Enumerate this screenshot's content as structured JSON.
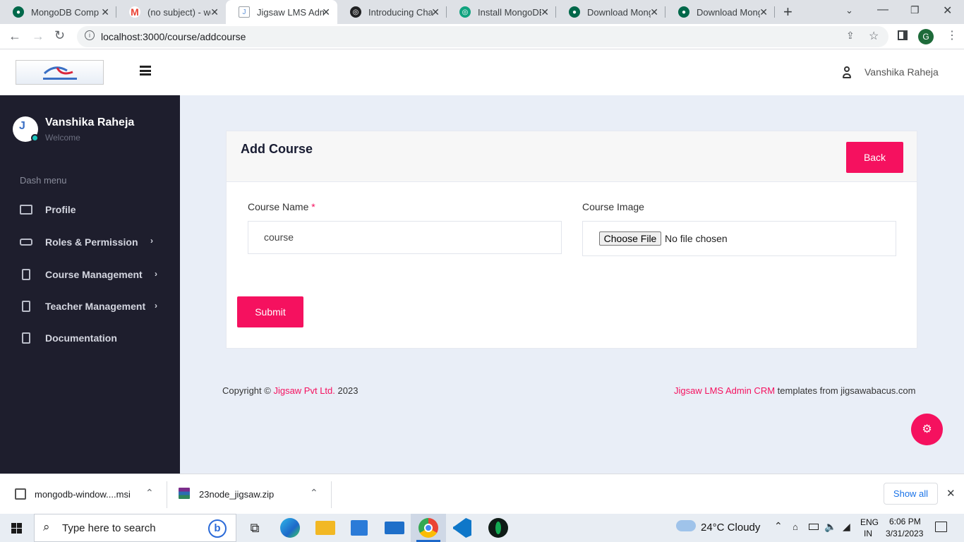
{
  "browser": {
    "tabs": [
      {
        "title": "MongoDB Comp",
        "active": false,
        "fav_color": "#00684a"
      },
      {
        "title": "(no subject) - wel",
        "active": false,
        "fav_color": "#ea4335"
      },
      {
        "title": "Jigsaw LMS Adm",
        "active": true,
        "fav_color": "#5b8fd6"
      },
      {
        "title": "Introducing Chat",
        "active": false,
        "fav_color": "#202123"
      },
      {
        "title": "Install MongoDB",
        "active": false,
        "fav_color": "#10a37f"
      },
      {
        "title": "Download Mong",
        "active": false,
        "fav_color": "#00684a"
      },
      {
        "title": "Download Mong",
        "active": false,
        "fav_color": "#00684a"
      }
    ],
    "new_tab": "+",
    "url": "localhost:3000/course/addcourse",
    "profile_initial": "G"
  },
  "header": {
    "user_name": "Vanshika Raheja"
  },
  "sidebar": {
    "user_name": "Vanshika Raheja",
    "user_status": "Welcome",
    "menu_title": "Dash menu",
    "items": [
      {
        "label": "Profile",
        "has_chevron": false
      },
      {
        "label": "Roles & Permission",
        "has_chevron": true
      },
      {
        "label": "Course Management",
        "has_chevron": true
      },
      {
        "label": "Teacher Management",
        "has_chevron": true
      },
      {
        "label": "Documentation",
        "has_chevron": false
      }
    ]
  },
  "form": {
    "title": "Add Course",
    "back_label": "Back",
    "course_name_label": "Course Name",
    "required_marker": "*",
    "course_name_value": "course",
    "course_image_label": "Course Image",
    "choose_file_label": "Choose File",
    "no_file_text": "No file chosen",
    "submit_label": "Submit"
  },
  "footer": {
    "copyright_prefix": "Copyright ©",
    "company": "Jigsaw Pvt Ltd.",
    "year": "2023",
    "product": "Jigsaw LMS Admin CRM",
    "templates_text": "templates from jigsawabacus.com"
  },
  "downloads": {
    "items": [
      {
        "name": "mongodb-window....msi"
      },
      {
        "name": "23node_jigsaw.zip"
      }
    ],
    "show_all": "Show all"
  },
  "taskbar": {
    "search_placeholder": "Type here to search",
    "weather": "24°C  Cloudy",
    "lang": "ENG",
    "region": "IN",
    "time": "6:06 PM",
    "date": "3/31/2023"
  },
  "colors": {
    "accent": "#f5115f",
    "sidebar_bg": "#1e1e2d",
    "content_bg": "#e9eef7"
  }
}
